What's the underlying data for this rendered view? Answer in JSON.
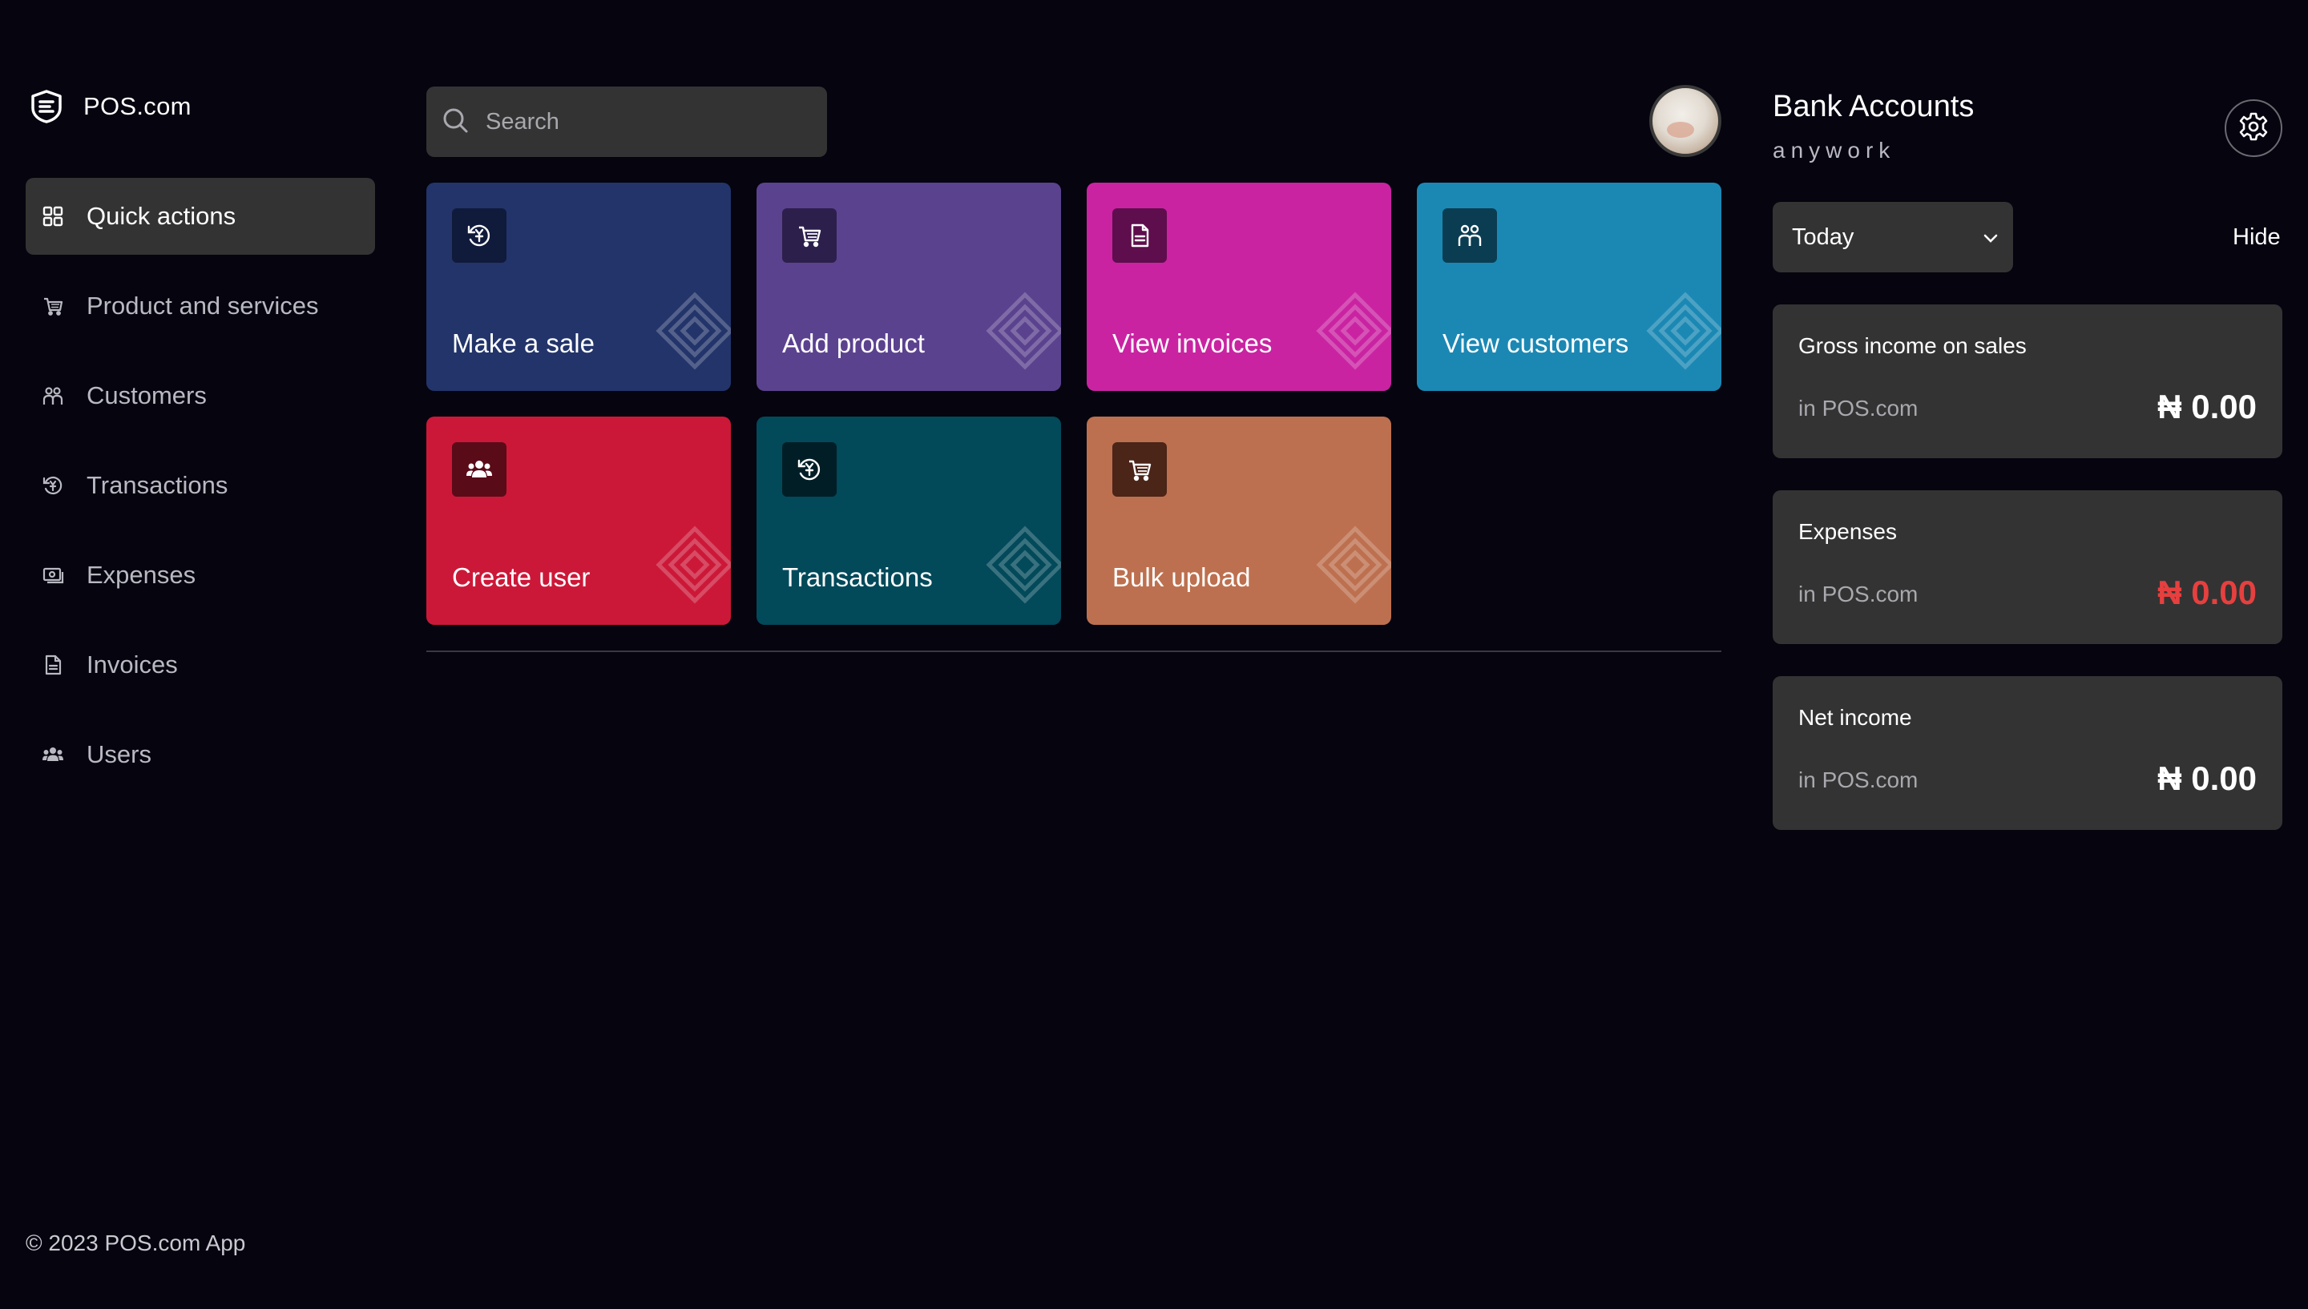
{
  "brand": {
    "name": "POS.com"
  },
  "sidebar": {
    "items": [
      {
        "label": "Quick actions",
        "icon": "grid-icon",
        "active": true
      },
      {
        "label": "Product and services",
        "icon": "cart-icon"
      },
      {
        "label": "Customers",
        "icon": "customers-icon"
      },
      {
        "label": "Transactions",
        "icon": "transactions-icon"
      },
      {
        "label": "Expenses",
        "icon": "expenses-icon"
      },
      {
        "label": "Invoices",
        "icon": "invoice-icon"
      },
      {
        "label": "Users",
        "icon": "users-icon"
      }
    ],
    "copyright": "© 2023 POS.com App"
  },
  "search": {
    "placeholder": "Search"
  },
  "tiles": [
    {
      "label": "Make a sale",
      "icon": "yen-cycle-icon",
      "color": "#22346a"
    },
    {
      "label": "Add product",
      "icon": "cart-icon",
      "color": "#5b428f"
    },
    {
      "label": "View invoices",
      "icon": "invoice-icon",
      "color": "#c923a2"
    },
    {
      "label": "View customers",
      "icon": "customers-icon",
      "color": "#1b88b4"
    },
    {
      "label": "Create user",
      "icon": "users-icon",
      "color": "#cc1838"
    },
    {
      "label": "Transactions",
      "icon": "yen-cycle-icon",
      "color": "#02495a"
    },
    {
      "label": "Bulk upload",
      "icon": "cart-icon",
      "color": "#bd704f"
    }
  ],
  "panel": {
    "title": "Bank Accounts",
    "subtitle": "anywork",
    "period": "Today",
    "hide_label": "Hide",
    "cards": [
      {
        "title": "Gross income on sales",
        "source": "in POS.com",
        "amount": "₦ 0.00",
        "amount_color": "#ffffff"
      },
      {
        "title": "Expenses",
        "source": "in POS.com",
        "amount": "₦ 0.00",
        "amount_color": "#e5403f"
      },
      {
        "title": "Net income",
        "source": "in POS.com",
        "amount": "₦ 0.00",
        "amount_color": "#ffffff"
      }
    ]
  }
}
